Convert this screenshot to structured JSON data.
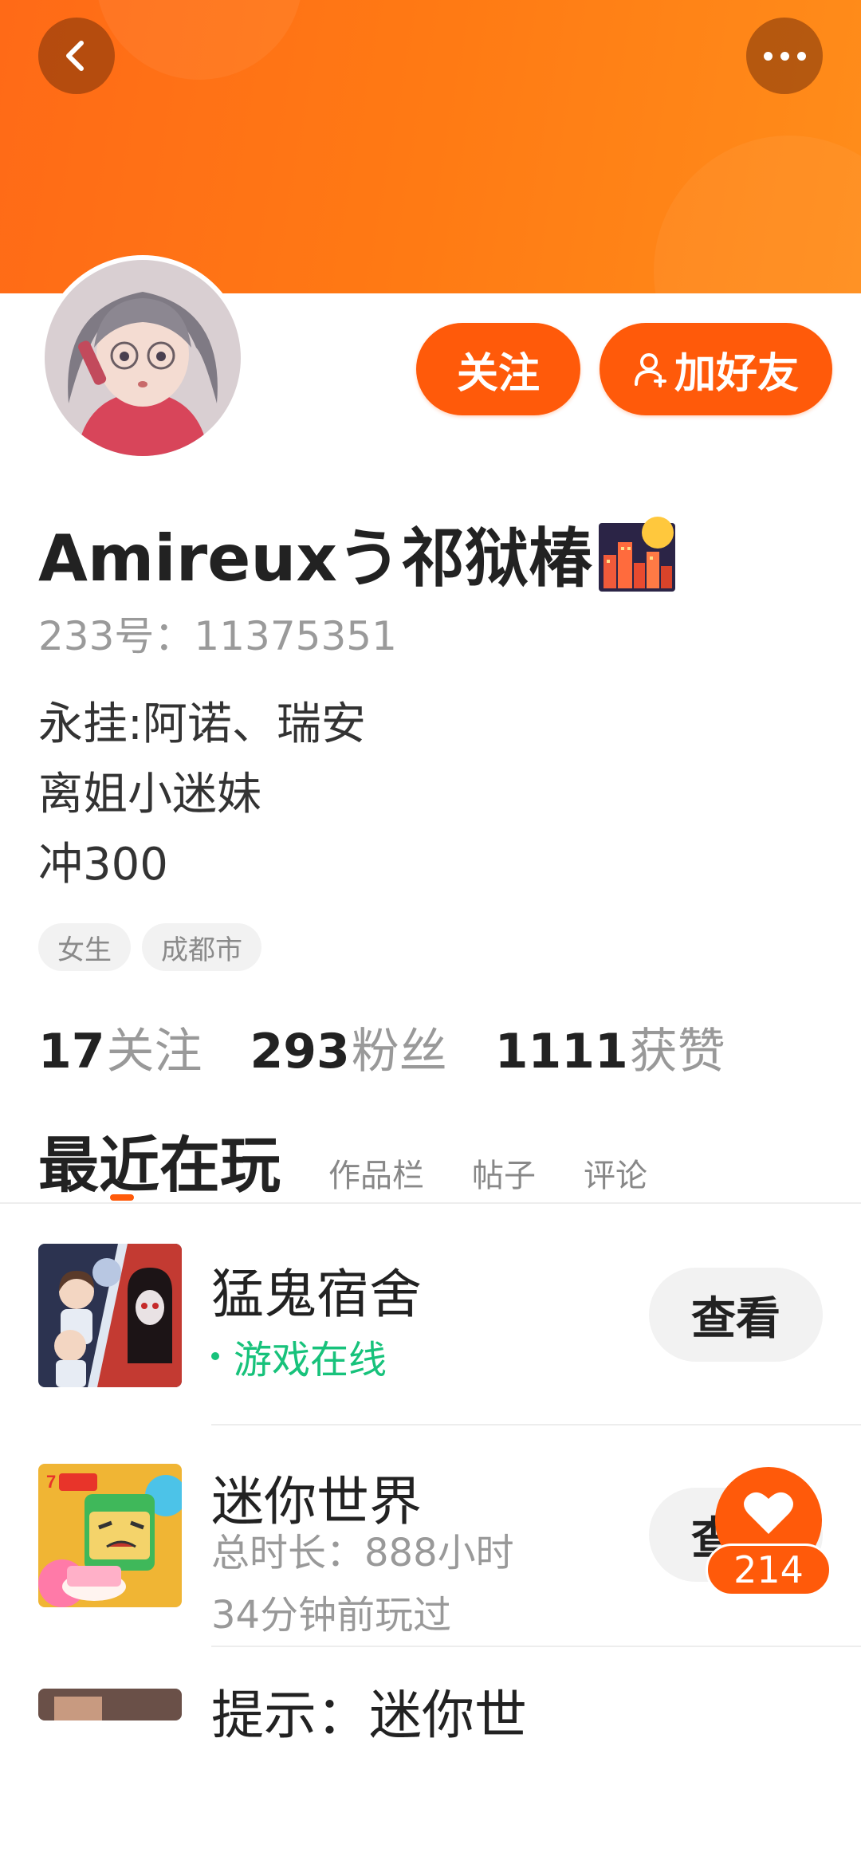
{
  "header": {
    "back_icon": "chevron-left-icon",
    "more_icon": "more-dots-icon",
    "banner_color": "#ff7a14"
  },
  "profile": {
    "avatar_alt": "avatar",
    "follow_label": "关注",
    "add_friend_label": "加好友",
    "add_friend_icon": "add-user-icon",
    "name": "Amireuxう祁狱椿",
    "name_emoji_icon": "city-sunset-icon",
    "uid": "233号：11375351",
    "bio": [
      "永挂:阿诺、瑞安",
      "离姐小迷妹",
      "冲300"
    ],
    "tags": [
      "女生",
      "成都市"
    ]
  },
  "stats": {
    "following": {
      "count": "17",
      "label": "关注"
    },
    "fans": {
      "count": "293",
      "label": "粉丝"
    },
    "likes": {
      "count": "1111",
      "label": "获赞"
    }
  },
  "tabs": {
    "active": "最近在玩",
    "items": [
      "作品栏",
      "帖子",
      "评论"
    ]
  },
  "games": [
    {
      "title": "猛鬼宿舍",
      "status": "游戏在线",
      "button": "查看"
    },
    {
      "title": "迷你世界",
      "sub1": "总时长：888小时",
      "sub2": "34分钟前玩过",
      "button": "查看"
    },
    {
      "title": "提示：迷你世"
    }
  ],
  "like_fab": {
    "icon": "heart-icon",
    "count": "214"
  },
  "colors": {
    "accent": "#ff5a0a",
    "online": "#17c27b"
  }
}
